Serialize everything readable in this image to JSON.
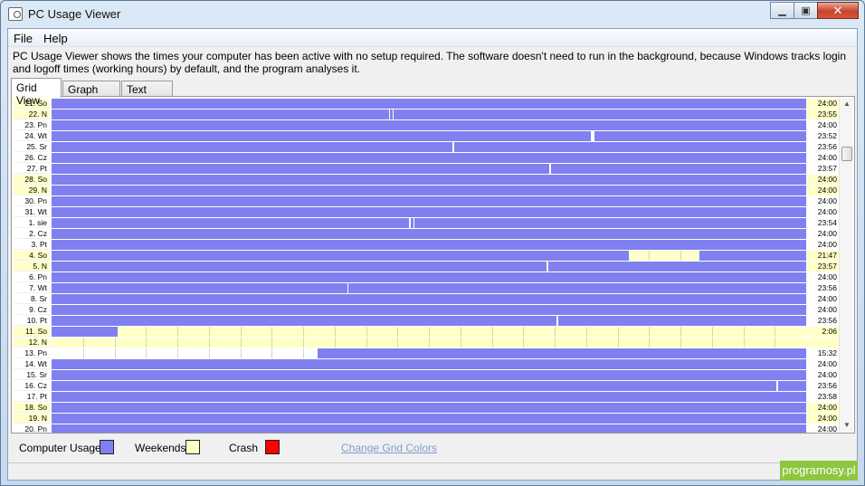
{
  "window": {
    "title": "PC Usage Viewer"
  },
  "menu": [
    "File",
    "Help"
  ],
  "description": "PC Usage Viewer shows the times your computer has been active with no setup required. The software doesn't need to run in the background, because Windows tracks login and logoff times (working hours) by default, and the program analyses it.",
  "tabs": [
    {
      "label": "Grid View",
      "active": true
    },
    {
      "label": "Graph View",
      "active": false
    },
    {
      "label": "Text View",
      "active": false
    }
  ],
  "grid": {
    "columns": 24,
    "colors": {
      "usage": "#8080f0",
      "weekend": "#ffffc8",
      "crash": "#ff0000"
    },
    "rows": [
      {
        "date": "21. So",
        "weekend": true,
        "total": "24:00",
        "usage": [
          [
            0,
            24
          ]
        ]
      },
      {
        "date": "22. N",
        "weekend": true,
        "total": "23:55",
        "usage": [
          [
            0,
            10.73
          ],
          [
            10.77,
            10.84
          ],
          [
            10.88,
            24
          ]
        ]
      },
      {
        "date": "23. Pn",
        "weekend": false,
        "total": "24:00",
        "usage": [
          [
            0,
            24
          ]
        ]
      },
      {
        "date": "24. Wt",
        "weekend": false,
        "total": "23:52",
        "usage": [
          [
            0,
            17.14
          ],
          [
            17.28,
            24
          ]
        ]
      },
      {
        "date": "25. Sr",
        "weekend": false,
        "total": "23:56",
        "usage": [
          [
            0,
            12.76
          ],
          [
            12.81,
            24
          ]
        ]
      },
      {
        "date": "26. Cz",
        "weekend": false,
        "total": "24:00",
        "usage": [
          [
            0,
            24
          ]
        ]
      },
      {
        "date": "27. Pt",
        "weekend": false,
        "total": "23:57",
        "usage": [
          [
            0,
            15.84
          ],
          [
            15.89,
            24
          ]
        ]
      },
      {
        "date": "28. So",
        "weekend": true,
        "total": "24:00",
        "usage": [
          [
            0,
            24
          ]
        ]
      },
      {
        "date": "29. N",
        "weekend": true,
        "total": "24:00",
        "usage": [
          [
            0,
            24
          ]
        ]
      },
      {
        "date": "30. Pn",
        "weekend": false,
        "total": "24:00",
        "usage": [
          [
            0,
            24
          ]
        ]
      },
      {
        "date": "31. Wt",
        "weekend": false,
        "total": "24:00",
        "usage": [
          [
            0,
            24
          ]
        ]
      },
      {
        "date": "1. sie",
        "weekend": false,
        "total": "23:54",
        "usage": [
          [
            0,
            11.38
          ],
          [
            11.43,
            11.5
          ],
          [
            11.55,
            24
          ]
        ]
      },
      {
        "date": "2. Cz",
        "weekend": false,
        "total": "24:00",
        "usage": [
          [
            0,
            24
          ]
        ]
      },
      {
        "date": "3. Pt",
        "weekend": false,
        "total": "24:00",
        "usage": [
          [
            0,
            24
          ]
        ]
      },
      {
        "date": "4. So",
        "weekend": true,
        "total": "21:47",
        "usage": [
          [
            0,
            18.37
          ],
          [
            20.6,
            24
          ]
        ]
      },
      {
        "date": "5. N",
        "weekend": true,
        "total": "23:57",
        "usage": [
          [
            0,
            15.74
          ],
          [
            15.79,
            24
          ]
        ]
      },
      {
        "date": "6. Pn",
        "weekend": false,
        "total": "24:00",
        "usage": [
          [
            0,
            24
          ]
        ]
      },
      {
        "date": "7. Wt",
        "weekend": false,
        "total": "23:56",
        "usage": [
          [
            0,
            9.4
          ],
          [
            9.45,
            24
          ]
        ]
      },
      {
        "date": "8. Sr",
        "weekend": false,
        "total": "24:00",
        "usage": [
          [
            0,
            24
          ]
        ]
      },
      {
        "date": "9. Cz",
        "weekend": false,
        "total": "24:00",
        "usage": [
          [
            0,
            24
          ]
        ]
      },
      {
        "date": "10. Pt",
        "weekend": false,
        "total": "23:56",
        "usage": [
          [
            0,
            16.07
          ],
          [
            16.12,
            24
          ]
        ]
      },
      {
        "date": "11. So",
        "weekend": true,
        "total": "2:06",
        "usage": [
          [
            0,
            2.1
          ]
        ]
      },
      {
        "date": "12. N",
        "weekend": true,
        "total": "",
        "usage": []
      },
      {
        "date": "13. Pn",
        "weekend": false,
        "total": "15:32",
        "usage": [
          [
            8.47,
            24
          ]
        ]
      },
      {
        "date": "14. Wt",
        "weekend": false,
        "total": "24:00",
        "usage": [
          [
            0,
            24
          ]
        ]
      },
      {
        "date": "15. Sr",
        "weekend": false,
        "total": "24:00",
        "usage": [
          [
            0,
            24
          ]
        ]
      },
      {
        "date": "16. Cz",
        "weekend": false,
        "total": "23:56",
        "usage": [
          [
            0,
            23.05
          ],
          [
            23.1,
            24
          ]
        ]
      },
      {
        "date": "17. Pt",
        "weekend": false,
        "total": "23:58",
        "usage": [
          [
            0,
            24
          ]
        ]
      },
      {
        "date": "18. So",
        "weekend": true,
        "total": "24:00",
        "usage": [
          [
            0,
            24
          ]
        ]
      },
      {
        "date": "19. N",
        "weekend": true,
        "total": "24:00",
        "usage": [
          [
            0,
            24
          ]
        ]
      },
      {
        "date": "20. Pn",
        "weekend": false,
        "total": "24:00",
        "usage": [
          [
            0,
            24
          ]
        ]
      }
    ]
  },
  "legend": {
    "usage_label": "Computer Usage",
    "weekends_label": "Weekends",
    "crash_label": "Crash",
    "change_colors_link": "Change Grid Colors"
  },
  "watermark": "programosy.pl"
}
